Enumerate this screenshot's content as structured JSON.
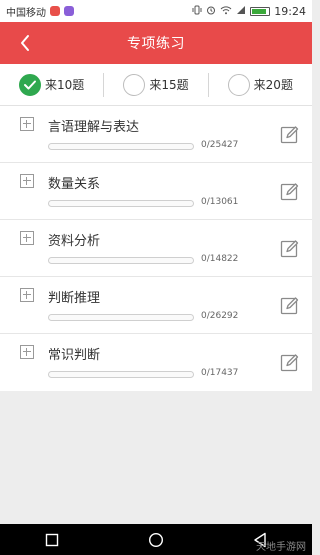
{
  "status_bar": {
    "carrier": "中国移动",
    "time": "19:24",
    "app_icon_colors": [
      "#e8504a",
      "#8a5fd8"
    ],
    "battery_level": 0.85,
    "icons": [
      "vibrate-icon",
      "alarm-icon",
      "wifi-icon",
      "signal-icon",
      "battery-icon"
    ]
  },
  "header": {
    "title": "专项练习",
    "back_icon": "chevron-left-icon",
    "color": "#e84a4a"
  },
  "question_count": {
    "options": [
      {
        "label": "来10题",
        "selected": true
      },
      {
        "label": "来15题",
        "selected": false
      },
      {
        "label": "来20题",
        "selected": false
      }
    ],
    "selected_color": "#2fa84f"
  },
  "categories": [
    {
      "title": "言语理解与表达",
      "count": "0/25427",
      "progress": 0
    },
    {
      "title": "数量关系",
      "count": "0/13061",
      "progress": 0
    },
    {
      "title": "资料分析",
      "count": "0/14822",
      "progress": 0
    },
    {
      "title": "判断推理",
      "count": "0/26292",
      "progress": 0
    },
    {
      "title": "常识判断",
      "count": "0/17437",
      "progress": 0
    }
  ],
  "nav_bar": {
    "buttons": [
      "recent-apps-icon",
      "home-icon",
      "back-icon"
    ]
  },
  "watermark": "天地手游网"
}
